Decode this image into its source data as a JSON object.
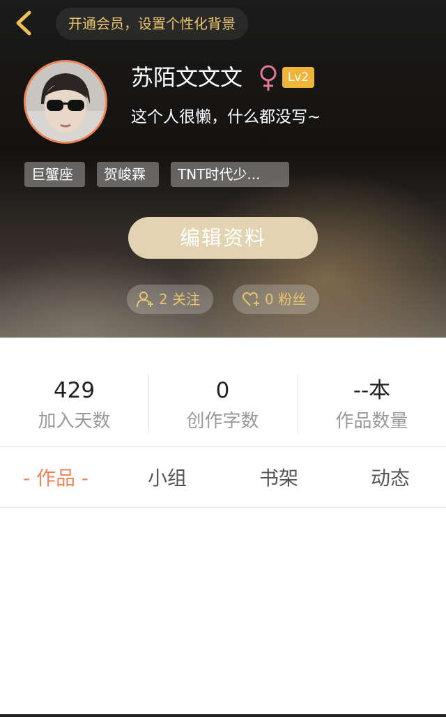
{
  "header": {
    "vip_banner": "开通会员，设置个性化背景",
    "username": "苏陌文文文",
    "level": "Lv2",
    "bio": "这个人很懒，什么都没写~",
    "tags": [
      "巨蟹座",
      "贺峻霖",
      "TNT时代少..."
    ],
    "edit_button": "编辑资料",
    "following": "2 关注",
    "followers": "0 粉丝"
  },
  "stats": [
    {
      "value": "429",
      "label": "加入天数"
    },
    {
      "value": "0",
      "label": "创作字数"
    },
    {
      "value": "--本",
      "label": "作品数量"
    }
  ],
  "tabs": [
    "- 作品 -",
    "小组",
    "书架",
    "动态"
  ],
  "colors": {
    "accent": "#f0855a",
    "gold": "#e9c46a",
    "level_badge": "#f0b43a",
    "gender": "#e07a9a"
  },
  "icons": {
    "back": "chevron-left-icon",
    "gender": "female-icon",
    "following": "add-user-icon",
    "followers": "heart-plus-icon"
  }
}
